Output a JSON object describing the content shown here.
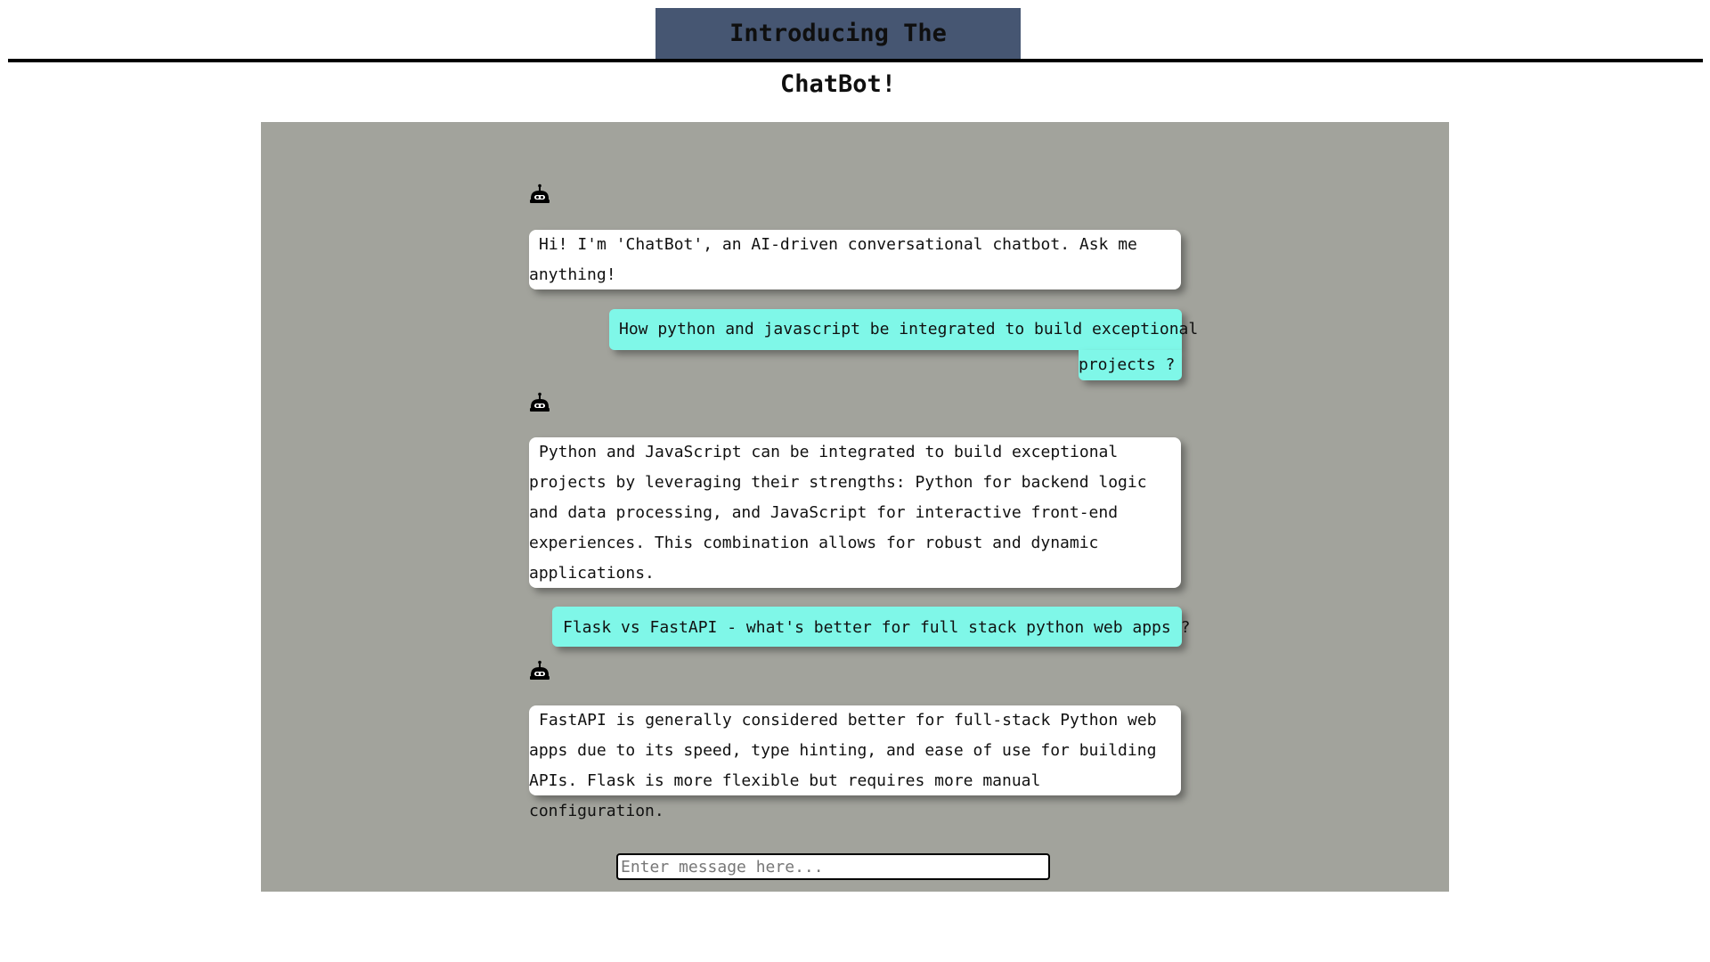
{
  "header": {
    "title": "Introducing The ChatBot!"
  },
  "colors": {
    "title_bg": "#465672",
    "panel_bg": "#a2a39c",
    "bot_bubble": "#ffffff",
    "user_bubble": "#7ff7e8"
  },
  "conversation": {
    "bot_icon": "robot-icon",
    "messages": [
      {
        "role": "bot",
        "text": "Hi! I'm 'ChatBot', an AI-driven conversational chatbot. Ask me anything!"
      },
      {
        "role": "user",
        "line1": "How python and javascript be integrated to build exceptional",
        "line2": "projects ?"
      },
      {
        "role": "bot",
        "text": "Python and JavaScript can be integrated to build exceptional projects by leveraging their strengths: Python for backend logic and data processing, and JavaScript for interactive front-end experiences. This combination allows for robust and dynamic applications."
      },
      {
        "role": "user",
        "text": "Flask vs FastAPI - what's better for full stack python web apps ?"
      },
      {
        "role": "bot",
        "text": "FastAPI is generally considered better for full-stack Python web apps due to its speed, type hinting, and ease of use for building APIs. Flask is more flexible but requires more manual configuration."
      }
    ]
  },
  "composer": {
    "placeholder": "Enter message here...",
    "value": ""
  }
}
